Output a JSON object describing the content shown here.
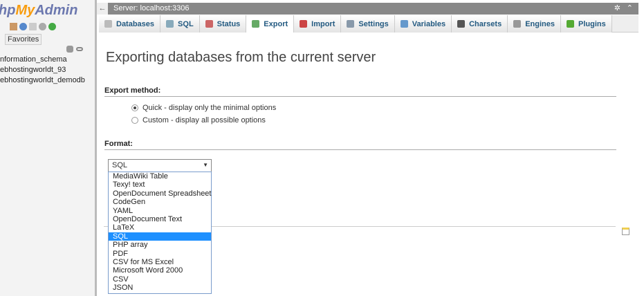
{
  "sidebar": {
    "logo_prefix": "hp",
    "logo_my": "My",
    "logo_admin": "Admin",
    "favorites": "Favorites",
    "databases": [
      "nformation_schema",
      "ebhostingworldt_93",
      "ebhostingworldt_demodb"
    ]
  },
  "topbar": {
    "server": "Server: localhost:3306"
  },
  "tabs": [
    {
      "label": "Databases",
      "icon": "database-icon",
      "color": "#bbb"
    },
    {
      "label": "SQL",
      "icon": "sql-icon",
      "color": "#8ab"
    },
    {
      "label": "Status",
      "icon": "status-icon",
      "color": "#c66"
    },
    {
      "label": "Export",
      "icon": "export-icon",
      "color": "#6a6"
    },
    {
      "label": "Import",
      "icon": "import-icon",
      "color": "#c44"
    },
    {
      "label": "Settings",
      "icon": "wrench-icon",
      "color": "#89a"
    },
    {
      "label": "Variables",
      "icon": "variables-icon",
      "color": "#69c"
    },
    {
      "label": "Charsets",
      "icon": "charsets-icon",
      "color": "#555"
    },
    {
      "label": "Engines",
      "icon": "engines-icon",
      "color": "#999"
    },
    {
      "label": "Plugins",
      "icon": "plugin-icon",
      "color": "#5a3"
    }
  ],
  "active_tab": "Export",
  "main": {
    "title": "Exporting databases from the current server",
    "export_method": "Export method:",
    "quick": "Quick - display only the minimal options",
    "custom": "Custom - display all possible options",
    "format": "Format:",
    "selected_format": "SQL",
    "options": [
      "MediaWiki Table",
      "Texy! text",
      "OpenDocument Spreadsheet",
      "CodeGen",
      "YAML",
      "OpenDocument Text",
      "LaTeX",
      "SQL",
      "PHP array",
      "PDF",
      "CSV for MS Excel",
      "Microsoft Word 2000",
      "CSV",
      "JSON"
    ]
  }
}
